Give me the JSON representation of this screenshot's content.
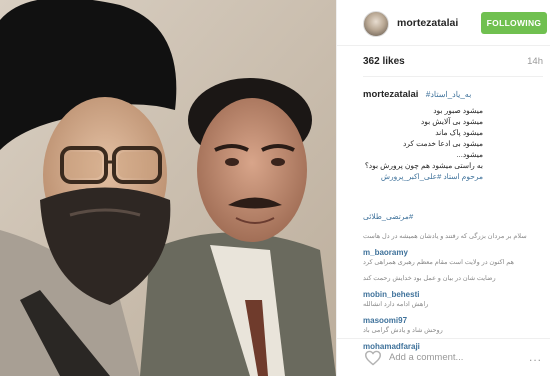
{
  "header": {
    "username": "mortezatalai",
    "follow_label": "FOLLOWING"
  },
  "stats": {
    "likes": "362 likes",
    "time_ago": "14h"
  },
  "caption": {
    "username": "mortezatalai",
    "hashtag": "#به_یاد_استاد",
    "lines": [
      "میشود صبور بود",
      "میشود بی آلایش بود",
      "میشود پاک ماند",
      "میشود بی ادعا خدمت کرد",
      "میشود...",
      "به راستی میشود هم چون پرورش بود؟",
      "مرحوم استاد #علی_اکبر_پرورش"
    ],
    "signature": "#مرتضی_طلائی"
  },
  "comments": [
    {
      "user": "",
      "text": "سلام بر مردان بزرگی که رفتند و یادشان همیشه در دل هاست"
    },
    {
      "user": "m_baoramy",
      "text": "هم اکنون در ولایت است مقام معظم رهبری همراهی کرد"
    },
    {
      "user": "",
      "text": "رضایت شان در بیان و عمل بود خدایش رحمت کند"
    },
    {
      "user": "mobin_behesti",
      "text": "راهش ادامه دارد انشالله"
    },
    {
      "user": "masoomi97",
      "text": "روحش شاد و یادش گرامی باد"
    },
    {
      "user": "mohamadfaraji",
      "text": ""
    }
  ],
  "footer": {
    "add_comment_placeholder": "Add a comment...",
    "more_label": "..."
  },
  "colors": {
    "follow_green": "#70c050",
    "link_blue": "#3f729b",
    "muted_gray": "#999999"
  },
  "icons": {
    "like": "heart-outline-icon",
    "more": "ellipsis-icon"
  }
}
